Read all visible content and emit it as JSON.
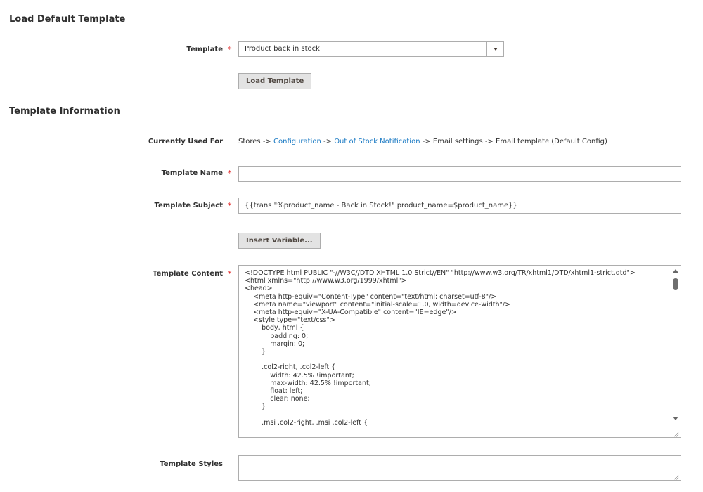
{
  "load_section": {
    "title": "Load Default Template",
    "template_label": "Template",
    "required_mark": "*",
    "template_selected": "Product back in stock",
    "load_button": "Load Template"
  },
  "info_section": {
    "title": "Template Information",
    "used_for_label": "Currently Used For",
    "used_for": {
      "part1": "Stores -> ",
      "link1": "Configuration",
      "part2": " -> ",
      "link2": "Out of Stock Notification",
      "part3": " -> Email settings -> Email template  (Default Config)"
    },
    "name_label": "Template Name",
    "name_value": "",
    "subject_label": "Template Subject",
    "subject_value": "{{trans \"%product_name - Back in Stock!\" product_name=$product_name}}",
    "insert_variable_button": "Insert Variable...",
    "content_label": "Template Content",
    "content_value": "<!DOCTYPE html PUBLIC \"-//W3C//DTD XHTML 1.0 Strict//EN\" \"http://www.w3.org/TR/xhtml1/DTD/xhtml1-strict.dtd\">\n<html xmlns=\"http://www.w3.org/1999/xhtml\">\n<head>\n    <meta http-equiv=\"Content-Type\" content=\"text/html; charset=utf-8\"/>\n    <meta name=\"viewport\" content=\"initial-scale=1.0, width=device-width\"/>\n    <meta http-equiv=\"X-UA-Compatible\" content=\"IE=edge\"/>\n    <style type=\"text/css\">\n        body, html {\n            padding: 0;\n            margin: 0;\n        }\n\n        .col2-right, .col2-left {\n            width: 42.5% !important;\n            max-width: 42.5% !important;\n            float: left;\n            clear: none;\n        }\n\n        .msi .col2-right, .msi .col2-left {",
    "styles_label": "Template Styles",
    "styles_value": ""
  }
}
